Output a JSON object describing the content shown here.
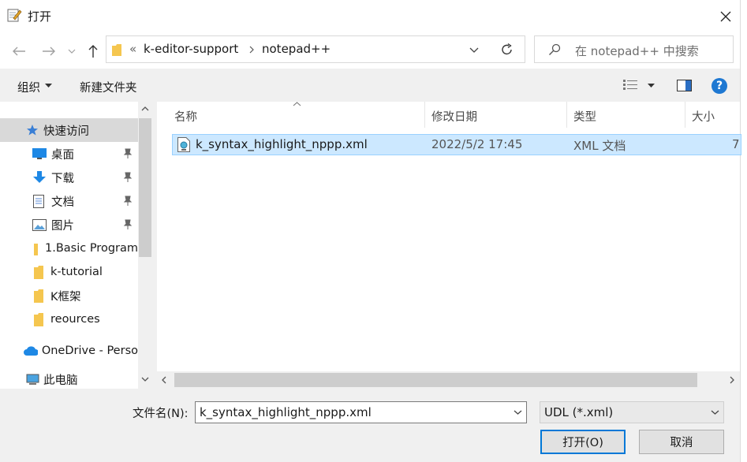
{
  "window": {
    "title": "打开"
  },
  "address": {
    "overflow": "«",
    "crumbs": [
      "k-editor-support",
      "notepad++"
    ]
  },
  "search": {
    "placeholder": "在 notepad++ 中搜索"
  },
  "toolbar": {
    "organize": "组织",
    "new_folder": "新建文件夹"
  },
  "sidebar": {
    "items": [
      {
        "label": "快速访问",
        "icon": "star-icon"
      },
      {
        "label": "桌面",
        "icon": "desktop-icon",
        "pinned": true
      },
      {
        "label": "下载",
        "icon": "download-icon",
        "pinned": true
      },
      {
        "label": "文档",
        "icon": "document-icon",
        "pinned": true
      },
      {
        "label": "图片",
        "icon": "picture-icon",
        "pinned": true
      },
      {
        "label": "1.Basic Program",
        "icon": "folder-icon"
      },
      {
        "label": "k-tutorial",
        "icon": "folder-icon"
      },
      {
        "label": "K框架",
        "icon": "folder-icon"
      },
      {
        "label": "reources",
        "icon": "folder-icon"
      },
      {
        "label": "OneDrive - Perso",
        "icon": "cloud-icon"
      },
      {
        "label": "此电脑",
        "icon": "computer-icon"
      }
    ]
  },
  "files": {
    "columns": [
      "名称",
      "修改日期",
      "类型",
      "大小"
    ],
    "rows": [
      {
        "name": "k_syntax_highlight_nppp.xml",
        "modified": "2022/5/2 17:45",
        "type": "XML 文档",
        "size": "7"
      }
    ]
  },
  "footer": {
    "filename_label": "文件名(N):",
    "filename_value": "k_syntax_highlight_nppp.xml",
    "filetype": "UDL (*.xml)",
    "open": "打开(O)",
    "cancel": "取消"
  },
  "colors": {
    "selection": "#cce8ff",
    "selection_border": "#99d1ff",
    "help": "#1e78d2",
    "folder": "#f5c64f"
  }
}
